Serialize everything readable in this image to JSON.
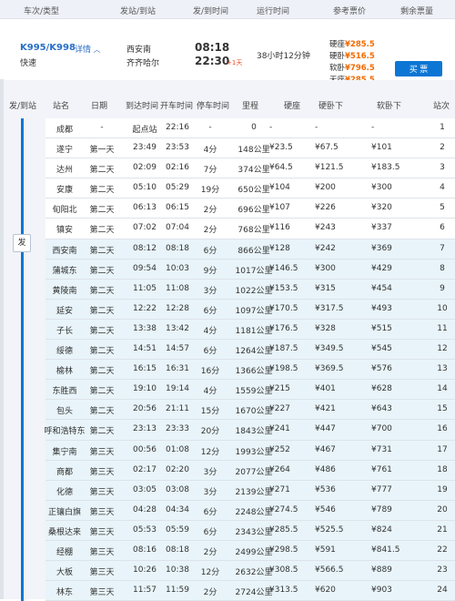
{
  "header": {
    "col_train": "车次/类型",
    "col_station": "发站/到站",
    "col_time": "发/到时间",
    "col_duration": "运行时间",
    "col_price": "参考票价",
    "col_remain": "剩余票量"
  },
  "train": {
    "number": "K995/K998",
    "detail": "详情",
    "type": "快速",
    "from": "西安南",
    "to": "齐齐哈尔",
    "dep_time": "08:18",
    "arr_time": "22:30",
    "plus_days": "+1天",
    "duration": "38小时12分钟",
    "prices": [
      {
        "label": "硬座",
        "value": "¥285.5"
      },
      {
        "label": "硬卧",
        "value": "¥516.5"
      },
      {
        "label": "软卧",
        "value": "¥796.5"
      },
      {
        "label": "无座",
        "value": "¥285.5"
      }
    ],
    "buy_label": "买 票"
  },
  "detail_header": {
    "from_to": "发/到站",
    "station": "站名",
    "day": "日期",
    "arrive": "到达时间",
    "depart": "开车时间",
    "stop": "停车时间",
    "mileage": "里程",
    "hard_seat": "硬座",
    "hard_sleeper": "硬卧下",
    "soft_sleeper": "软卧下",
    "seq": "站次"
  },
  "depart_tag": "发",
  "stops": [
    {
      "name": "成都",
      "day": "-",
      "arr": "起点站",
      "dep": "22:16",
      "stop": "-",
      "km": "0",
      "hz": "-",
      "hzx": "-",
      "rwx": "-",
      "no": "1"
    },
    {
      "name": "遂宁",
      "day": "第一天",
      "arr": "23:49",
      "dep": "23:53",
      "stop": "4分",
      "km": "148公里",
      "hz": "¥23.5",
      "hzx": "¥67.5",
      "rwx": "¥101",
      "no": "2"
    },
    {
      "name": "达州",
      "day": "第二天",
      "arr": "02:09",
      "dep": "02:16",
      "stop": "7分",
      "km": "374公里",
      "hz": "¥64.5",
      "hzx": "¥121.5",
      "rwx": "¥183.5",
      "no": "3"
    },
    {
      "name": "安康",
      "day": "第二天",
      "arr": "05:10",
      "dep": "05:29",
      "stop": "19分",
      "km": "650公里",
      "hz": "¥104",
      "hzx": "¥200",
      "rwx": "¥300",
      "no": "4"
    },
    {
      "name": "旬阳北",
      "day": "第二天",
      "arr": "06:13",
      "dep": "06:15",
      "stop": "2分",
      "km": "696公里",
      "hz": "¥107",
      "hzx": "¥226",
      "rwx": "¥320",
      "no": "5"
    },
    {
      "name": "镇安",
      "day": "第二天",
      "arr": "07:02",
      "dep": "07:04",
      "stop": "2分",
      "km": "768公里",
      "hz": "¥116",
      "hzx": "¥243",
      "rwx": "¥337",
      "no": "6"
    },
    {
      "name": "西安南",
      "day": "第二天",
      "arr": "08:12",
      "dep": "08:18",
      "stop": "6分",
      "km": "866公里",
      "hz": "¥128",
      "hzx": "¥242",
      "rwx": "¥369",
      "no": "7"
    },
    {
      "name": "蒲城东",
      "day": "第二天",
      "arr": "09:54",
      "dep": "10:03",
      "stop": "9分",
      "km": "1017公里",
      "hz": "¥146.5",
      "hzx": "¥300",
      "rwx": "¥429",
      "no": "8"
    },
    {
      "name": "黄陵南",
      "day": "第二天",
      "arr": "11:05",
      "dep": "11:08",
      "stop": "3分",
      "km": "1022公里",
      "hz": "¥153.5",
      "hzx": "¥315",
      "rwx": "¥454",
      "no": "9"
    },
    {
      "name": "延安",
      "day": "第二天",
      "arr": "12:22",
      "dep": "12:28",
      "stop": "6分",
      "km": "1097公里",
      "hz": "¥170.5",
      "hzx": "¥317.5",
      "rwx": "¥493",
      "no": "10"
    },
    {
      "name": "子长",
      "day": "第二天",
      "arr": "13:38",
      "dep": "13:42",
      "stop": "4分",
      "km": "1181公里",
      "hz": "¥176.5",
      "hzx": "¥328",
      "rwx": "¥515",
      "no": "11"
    },
    {
      "name": "绥德",
      "day": "第二天",
      "arr": "14:51",
      "dep": "14:57",
      "stop": "6分",
      "km": "1264公里",
      "hz": "¥187.5",
      "hzx": "¥349.5",
      "rwx": "¥545",
      "no": "12"
    },
    {
      "name": "榆林",
      "day": "第二天",
      "arr": "16:15",
      "dep": "16:31",
      "stop": "16分",
      "km": "1366公里",
      "hz": "¥198.5",
      "hzx": "¥369.5",
      "rwx": "¥576",
      "no": "13"
    },
    {
      "name": "东胜西",
      "day": "第二天",
      "arr": "19:10",
      "dep": "19:14",
      "stop": "4分",
      "km": "1559公里",
      "hz": "¥215",
      "hzx": "¥401",
      "rwx": "¥628",
      "no": "14"
    },
    {
      "name": "包头",
      "day": "第二天",
      "arr": "20:56",
      "dep": "21:11",
      "stop": "15分",
      "km": "1670公里",
      "hz": "¥227",
      "hzx": "¥421",
      "rwx": "¥643",
      "no": "15"
    },
    {
      "name": "呼和浩特东",
      "day": "第二天",
      "arr": "23:13",
      "dep": "23:33",
      "stop": "20分",
      "km": "1843公里",
      "hz": "¥241",
      "hzx": "¥447",
      "rwx": "¥700",
      "no": "16"
    },
    {
      "name": "集宁南",
      "day": "第三天",
      "arr": "00:56",
      "dep": "01:08",
      "stop": "12分",
      "km": "1993公里",
      "hz": "¥252",
      "hzx": "¥467",
      "rwx": "¥731",
      "no": "17"
    },
    {
      "name": "商都",
      "day": "第三天",
      "arr": "02:17",
      "dep": "02:20",
      "stop": "3分",
      "km": "2077公里",
      "hz": "¥264",
      "hzx": "¥486",
      "rwx": "¥761",
      "no": "18"
    },
    {
      "name": "化德",
      "day": "第三天",
      "arr": "03:05",
      "dep": "03:08",
      "stop": "3分",
      "km": "2139公里",
      "hz": "¥271",
      "hzx": "¥536",
      "rwx": "¥777",
      "no": "19"
    },
    {
      "name": "正镶白旗",
      "day": "第三天",
      "arr": "04:28",
      "dep": "04:34",
      "stop": "6分",
      "km": "2248公里",
      "hz": "¥274.5",
      "hzx": "¥546",
      "rwx": "¥789",
      "no": "20"
    },
    {
      "name": "桑根达来",
      "day": "第三天",
      "arr": "05:53",
      "dep": "05:59",
      "stop": "6分",
      "km": "2343公里",
      "hz": "¥285.5",
      "hzx": "¥525.5",
      "rwx": "¥824",
      "no": "21"
    },
    {
      "name": "经棚",
      "day": "第三天",
      "arr": "08:16",
      "dep": "08:18",
      "stop": "2分",
      "km": "2499公里",
      "hz": "¥298.5",
      "hzx": "¥591",
      "rwx": "¥841.5",
      "no": "22"
    },
    {
      "name": "大板",
      "day": "第三天",
      "arr": "10:26",
      "dep": "10:38",
      "stop": "12分",
      "km": "2632公里",
      "hz": "¥308.5",
      "hzx": "¥566.5",
      "rwx": "¥889",
      "no": "23"
    },
    {
      "name": "林东",
      "day": "第三天",
      "arr": "11:57",
      "dep": "11:59",
      "stop": "2分",
      "km": "2724公里",
      "hz": "¥313.5",
      "hzx": "¥620",
      "rwx": "¥903",
      "no": "24"
    }
  ]
}
